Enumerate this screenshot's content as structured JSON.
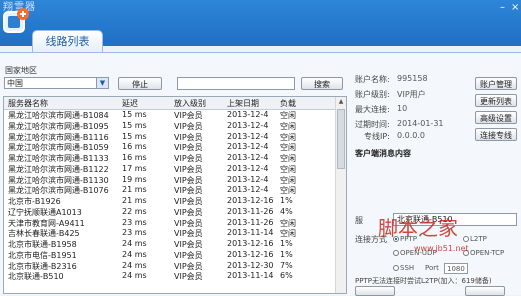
{
  "app": {
    "title": "翔雪器"
  },
  "tab": {
    "label": "线路列表"
  },
  "filter": {
    "region_label": "国家地区",
    "region_value": "中国",
    "stop_label": "停止",
    "search_value": "",
    "search_label": "搜索"
  },
  "table": {
    "headers": [
      "服务器名称",
      "延迟",
      "放入级别",
      "上架日期",
      "负载"
    ],
    "rows": [
      [
        "黑龙江哈尔滨市网通-B1084",
        "15 ms",
        "VIP会员",
        "2013-12-4",
        "空闲"
      ],
      [
        "黑龙江哈尔滨市网通-B1095",
        "15 ms",
        "VIP会员",
        "2013-12-4",
        "空闲"
      ],
      [
        "黑龙江哈尔滨市网通-B1116",
        "15 ms",
        "VIP会员",
        "2013-12-4",
        "空闲"
      ],
      [
        "黑龙江哈尔滨市网通-B1059",
        "16 ms",
        "VIP会员",
        "2013-12-4",
        "空闲"
      ],
      [
        "黑龙江哈尔滨市网通-B1133",
        "16 ms",
        "VIP会员",
        "2013-12-4",
        "空闲"
      ],
      [
        "黑龙江哈尔滨市网通-B1122",
        "17 ms",
        "VIP会员",
        "2013-12-4",
        "空闲"
      ],
      [
        "黑龙江哈尔滨市网通-B1130",
        "19 ms",
        "VIP会员",
        "2013-12-4",
        "空闲"
      ],
      [
        "黑龙江哈尔滨市网通-B1076",
        "21 ms",
        "VIP会员",
        "2013-12-4",
        "空闲"
      ],
      [
        "北京市-B1926",
        "21 ms",
        "VIP会员",
        "2013-12-16",
        "1%"
      ],
      [
        "辽宁抚顺联通A1013",
        "22 ms",
        "VIP会员",
        "2013-11-26",
        "4%"
      ],
      [
        "天津市教育网-A9411",
        "23 ms",
        "VIP会员",
        "2013-11-26",
        "空闲"
      ],
      [
        "吉林长春联通-B425",
        "23 ms",
        "VIP会员",
        "2013-11-14",
        "空闲"
      ],
      [
        "北京市联通-B1958",
        "24 ms",
        "VIP会员",
        "2013-12-16",
        "1%"
      ],
      [
        "北京市电信-B1951",
        "24 ms",
        "VIP会员",
        "2013-12-16",
        "1%"
      ],
      [
        "北京市联通-B2316",
        "24 ms",
        "VIP会员",
        "2013-12-30",
        "7%"
      ],
      [
        "北京联通-B510",
        "24 ms",
        "VIP会员",
        "2013-11-14",
        "6%"
      ]
    ]
  },
  "account": {
    "name_label": "账户名称:",
    "name_value": "995158",
    "level_label": "账户级别:",
    "level_value": "VIP用户",
    "maxconn_label": "最大连接:",
    "maxconn_value": "10",
    "expire_label": "过期时间:",
    "expire_value": "2014-01-31",
    "ip_label": "专线IP:",
    "ip_value": "0.0.0.0",
    "notice_label": "客户端消息内容"
  },
  "side_buttons": [
    "账户管理",
    "更新列表",
    "高级设置",
    "连接专线"
  ],
  "connect": {
    "server_label": "服",
    "server_value": "北京联通-B510",
    "mode_label": "连接方式",
    "options": [
      "PPTP",
      "L2TP",
      "OPEN-UDP",
      "OPEN-TCP",
      "SSH"
    ],
    "port_label": "Port",
    "port_value": "1080",
    "status_text": "PPTP无法连接时尝试L2TP(加入：619储备)"
  },
  "watermark": {
    "main": "脚本之家",
    "url": "www.jb51.net"
  },
  "colors": {
    "title_bar": "#1f6fc4",
    "accent": "#1f5fa8",
    "watermark": "#c8291e"
  }
}
